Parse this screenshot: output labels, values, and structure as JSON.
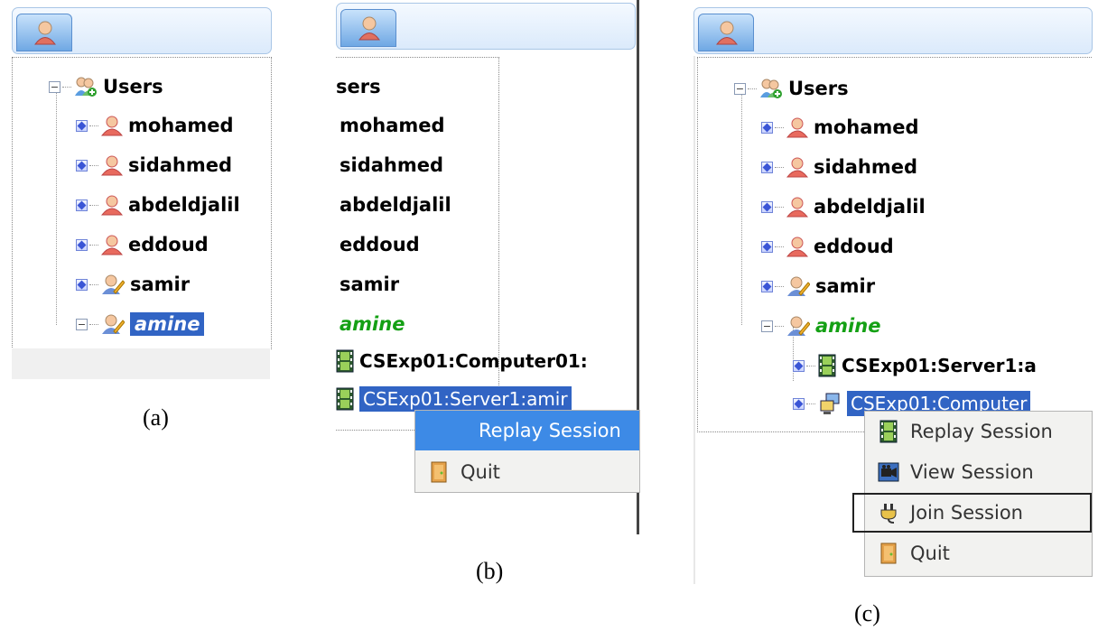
{
  "panel_a": {
    "caption": "(a)",
    "root": "Users",
    "users": [
      "mohamed",
      "sidahmed",
      "abdeldjalil",
      "eddoud",
      "samir"
    ],
    "selected": "amine"
  },
  "panel_b": {
    "caption": "(b)",
    "root_partial": "sers",
    "users": [
      "mohamed",
      "sidahmed",
      "abdeldjalil",
      "eddoud",
      "samir"
    ],
    "current_user": "amine",
    "sessions": [
      "CSExp01:Computer01:",
      "CSExp01:Server1:amir"
    ],
    "menu": [
      "Replay Session",
      "Quit"
    ]
  },
  "panel_c": {
    "caption": "(c)",
    "root": "Users",
    "users": [
      "mohamed",
      "sidahmed",
      "abdeldjalil",
      "eddoud",
      "samir"
    ],
    "current_user": "amine",
    "sessions": [
      "CSExp01:Server1:a",
      "CSExp01:Computer"
    ],
    "menu": [
      "Replay Session",
      "View Session",
      "Join Session",
      "Quit"
    ]
  },
  "colors": {
    "selection": "#3164c4",
    "menu_active": "#3d8ae6",
    "online_user": "#14a014"
  }
}
